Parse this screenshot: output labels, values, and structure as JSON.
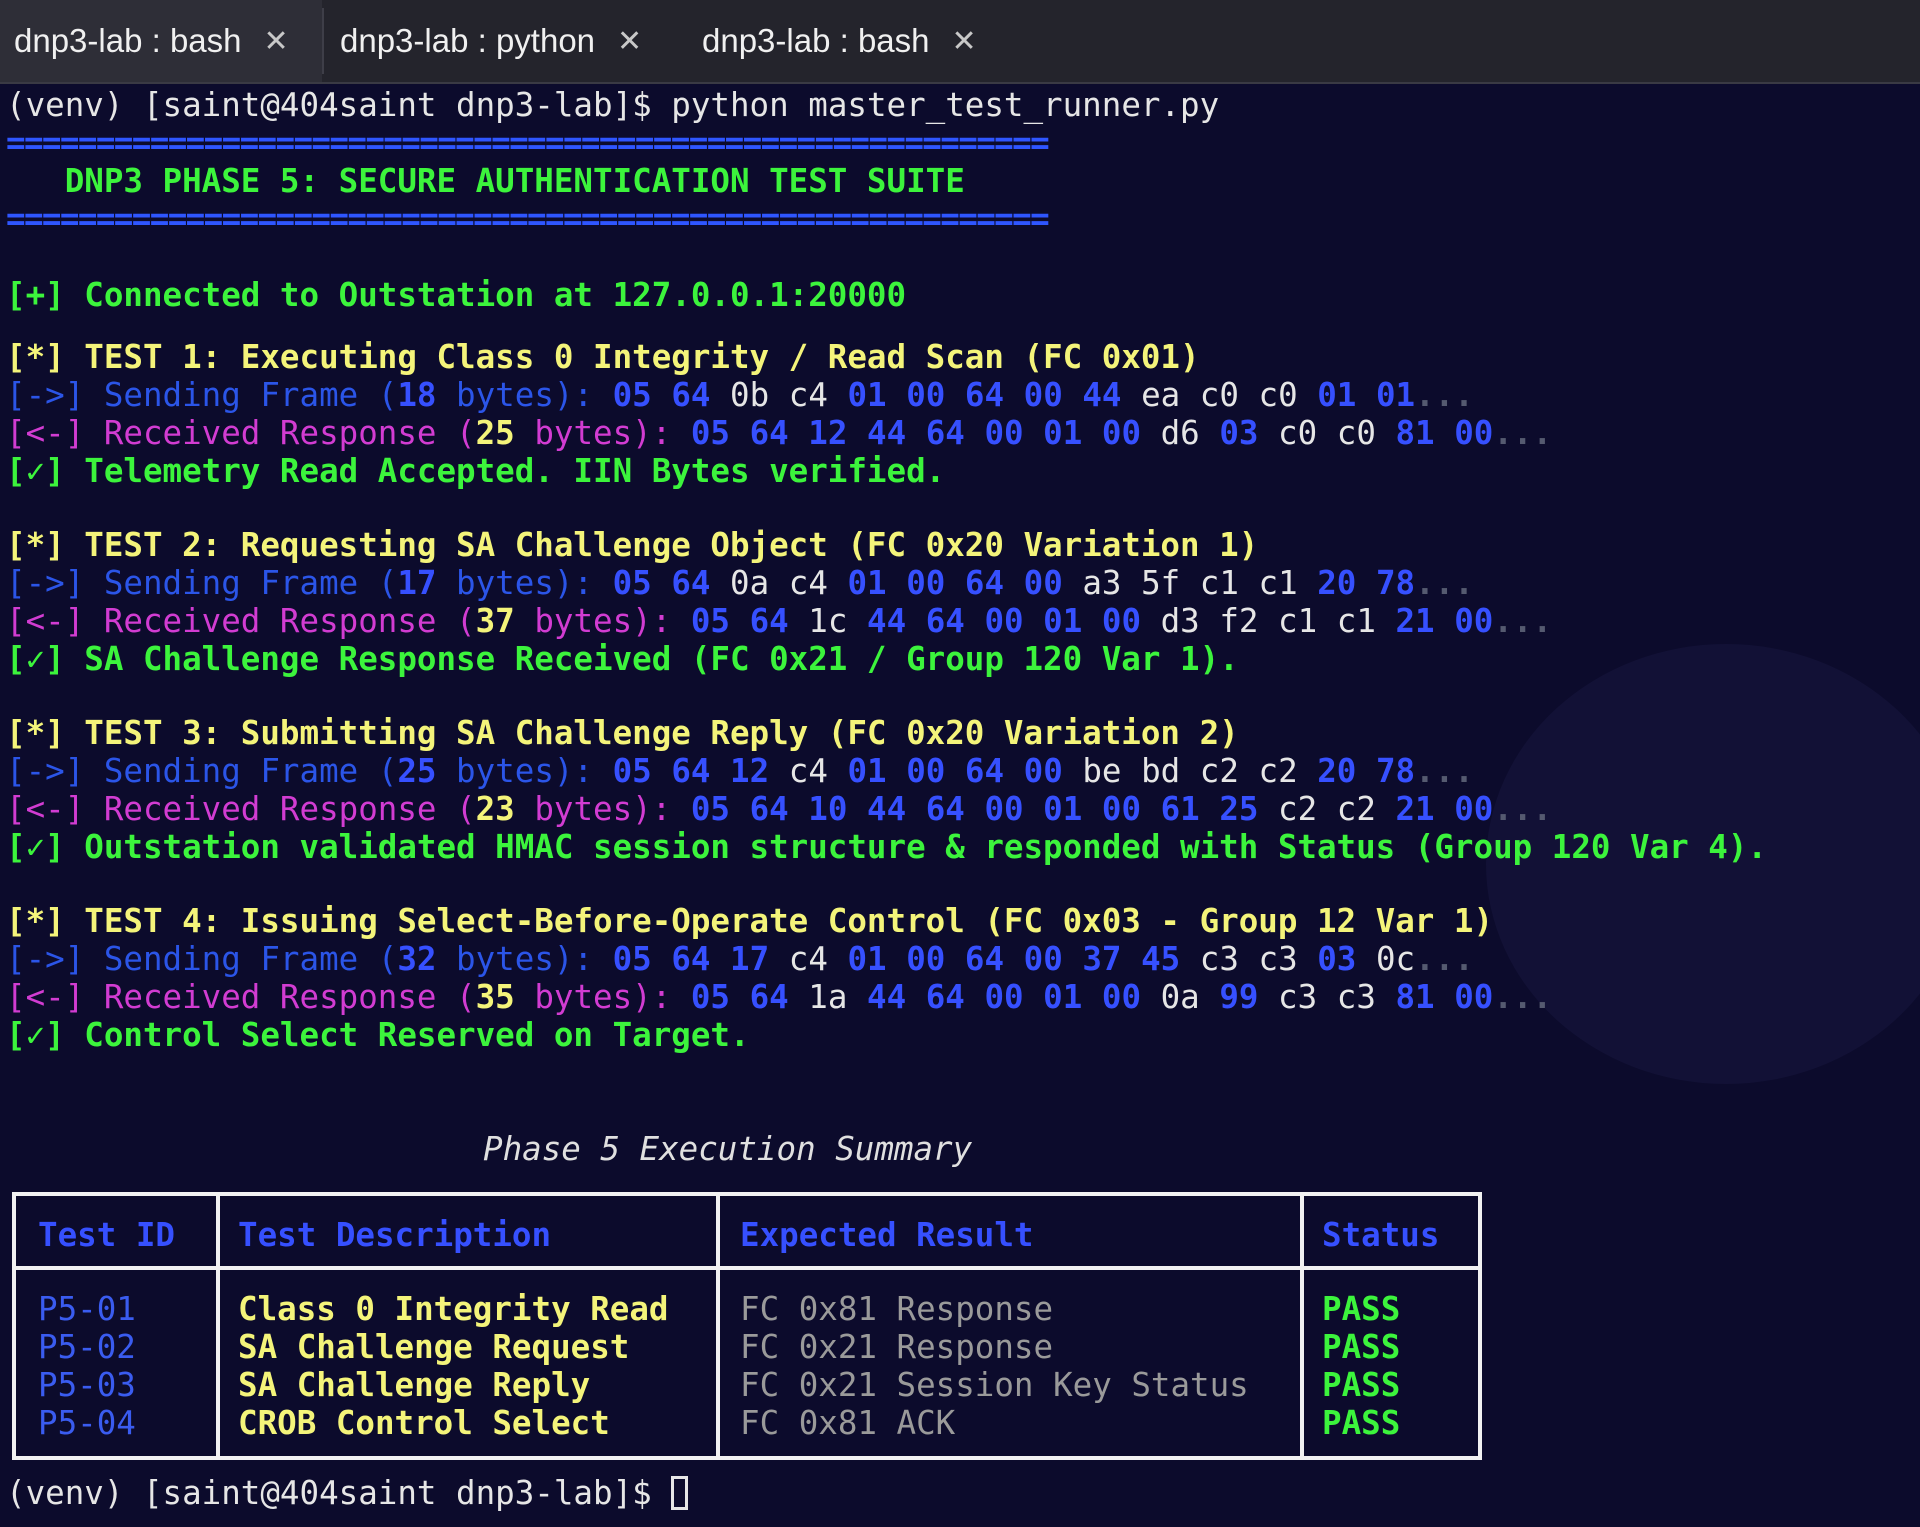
{
  "tabs": [
    {
      "label": "dnp3-lab : bash",
      "close": "✕"
    },
    {
      "label": "dnp3-lab : python",
      "close": "✕"
    },
    {
      "label": "dnp3-lab : bash",
      "close": "✕"
    }
  ],
  "prompt": "(venv) [saint@404saint dnp3-lab]$",
  "command": "python master_test_runner.py",
  "rule": "==========================================================",
  "banner": "   DNP3 PHASE 5: SECURE AUTHENTICATION TEST SUITE",
  "connected": "[+] Connected to Outstation at 127.0.0.1:20000",
  "tests": [
    {
      "header": "[*] TEST 1: Executing Class 0 Integrity / Read Scan (FC 0x01)",
      "send_prefix": "[->] Sending Frame (",
      "send_count": "18",
      "send_mid": " bytes): ",
      "send_bytes": [
        "05",
        "64",
        "0b",
        "c4",
        "01",
        "00",
        "64",
        "00",
        "44",
        "ea",
        "c0",
        "c0",
        "01",
        "01"
      ],
      "send_colors": [
        "b",
        "b",
        "w",
        "w",
        "b",
        "b",
        "b",
        "b",
        "b",
        "w",
        "w",
        "w",
        "b",
        "b"
      ],
      "recv_prefix": "[<-] Received Response (",
      "recv_count": "25",
      "recv_mid": " bytes): ",
      "recv_bytes": [
        "05",
        "64",
        "12",
        "44",
        "64",
        "00",
        "01",
        "00",
        "d6",
        "03",
        "c0",
        "c0",
        "81",
        "00"
      ],
      "recv_colors": [
        "b",
        "b",
        "b",
        "b",
        "b",
        "b",
        "b",
        "b",
        "w",
        "b",
        "w",
        "w",
        "b",
        "b"
      ],
      "ellipsis": "...",
      "result": "[✓] Telemetry Read Accepted. IIN Bytes verified."
    },
    {
      "header": "[*] TEST 2: Requesting SA Challenge Object (FC 0x20 Variation 1)",
      "send_prefix": "[->] Sending Frame (",
      "send_count": "17",
      "send_mid": " bytes): ",
      "send_bytes": [
        "05",
        "64",
        "0a",
        "c4",
        "01",
        "00",
        "64",
        "00",
        "a3",
        "5f",
        "c1",
        "c1",
        "20",
        "78"
      ],
      "send_colors": [
        "b",
        "b",
        "w",
        "w",
        "b",
        "b",
        "b",
        "b",
        "w",
        "w",
        "w",
        "w",
        "b",
        "b"
      ],
      "recv_prefix": "[<-] Received Response (",
      "recv_count": "37",
      "recv_mid": " bytes): ",
      "recv_bytes": [
        "05",
        "64",
        "1c",
        "44",
        "64",
        "00",
        "01",
        "00",
        "d3",
        "f2",
        "c1",
        "c1",
        "21",
        "00"
      ],
      "recv_colors": [
        "b",
        "b",
        "w",
        "b",
        "b",
        "b",
        "b",
        "b",
        "w",
        "w",
        "w",
        "w",
        "b",
        "b"
      ],
      "ellipsis": "...",
      "result": "[✓] SA Challenge Response Received (FC 0x21 / Group 120 Var 1)."
    },
    {
      "header": "[*] TEST 3: Submitting SA Challenge Reply (FC 0x20 Variation 2)",
      "send_prefix": "[->] Sending Frame (",
      "send_count": "25",
      "send_mid": " bytes): ",
      "send_bytes": [
        "05",
        "64",
        "12",
        "c4",
        "01",
        "00",
        "64",
        "00",
        "be",
        "bd",
        "c2",
        "c2",
        "20",
        "78"
      ],
      "send_colors": [
        "b",
        "b",
        "b",
        "w",
        "b",
        "b",
        "b",
        "b",
        "w",
        "w",
        "w",
        "w",
        "b",
        "b"
      ],
      "recv_prefix": "[<-] Received Response (",
      "recv_count": "23",
      "recv_mid": " bytes): ",
      "recv_bytes": [
        "05",
        "64",
        "10",
        "44",
        "64",
        "00",
        "01",
        "00",
        "61",
        "25",
        "c2",
        "c2",
        "21",
        "00"
      ],
      "recv_colors": [
        "b",
        "b",
        "b",
        "b",
        "b",
        "b",
        "b",
        "b",
        "b",
        "b",
        "w",
        "w",
        "b",
        "b"
      ],
      "ellipsis": "...",
      "result": "[✓] Outstation validated HMAC session structure & responded with Status (Group 120 Var 4)."
    },
    {
      "header": "[*] TEST 4: Issuing Select-Before-Operate Control (FC 0x03 - Group 12 Var 1)",
      "send_prefix": "[->] Sending Frame (",
      "send_count": "32",
      "send_mid": " bytes): ",
      "send_bytes": [
        "05",
        "64",
        "17",
        "c4",
        "01",
        "00",
        "64",
        "00",
        "37",
        "45",
        "c3",
        "c3",
        "03",
        "0c"
      ],
      "send_colors": [
        "b",
        "b",
        "b",
        "w",
        "b",
        "b",
        "b",
        "b",
        "b",
        "b",
        "w",
        "w",
        "b",
        "w"
      ],
      "recv_prefix": "[<-] Received Response (",
      "recv_count": "35",
      "recv_mid": " bytes): ",
      "recv_bytes": [
        "05",
        "64",
        "1a",
        "44",
        "64",
        "00",
        "01",
        "00",
        "0a",
        "99",
        "c3",
        "c3",
        "81",
        "00"
      ],
      "recv_colors": [
        "b",
        "b",
        "w",
        "b",
        "b",
        "b",
        "b",
        "b",
        "w",
        "b",
        "w",
        "w",
        "b",
        "b"
      ],
      "ellipsis": "...",
      "result": "[✓] Control Select Reserved on Target."
    }
  ],
  "summary": {
    "title": "Phase 5 Execution Summary",
    "headers": [
      "Test ID",
      "Test Description",
      "Expected Result",
      "Status"
    ],
    "rows": [
      [
        "P5-01",
        "Class 0 Integrity Read",
        "FC 0x81 Response",
        "PASS"
      ],
      [
        "P5-02",
        "SA Challenge Request",
        "FC 0x21 Response",
        "PASS"
      ],
      [
        "P5-03",
        "SA Challenge Reply",
        "FC 0x21 Session Key Status",
        "PASS"
      ],
      [
        "P5-04",
        "CROB Control Select",
        "FC 0x81 ACK",
        "PASS"
      ]
    ]
  },
  "colors": {
    "background": "#0c0b2c",
    "green": "#3cf43c",
    "yellow": "#f4f47a",
    "blue": "#2b55e8",
    "magenta": "#d23cd2"
  }
}
